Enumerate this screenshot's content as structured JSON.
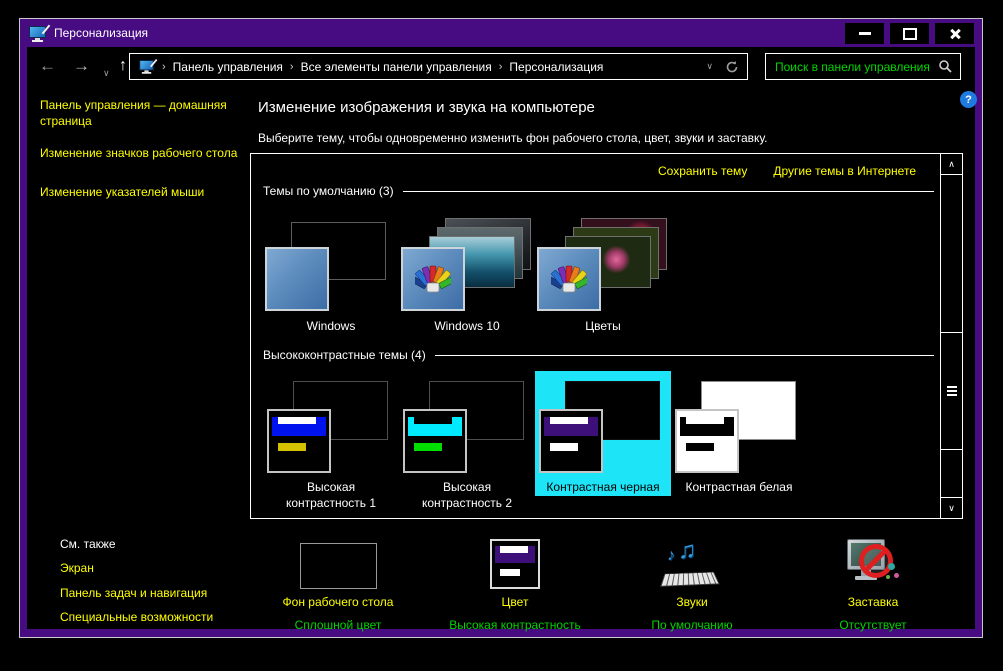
{
  "window": {
    "title": "Персонализация"
  },
  "nav": {
    "breadcrumb_items": [
      "Панель управления",
      "Все элементы панели управления",
      "Персонализация"
    ],
    "search_placeholder": "Поиск в панели управления"
  },
  "help": {
    "glyph": "?"
  },
  "sidebar": {
    "links": [
      "Панель управления — домашняя страница",
      "Изменение значков рабочего стола",
      "Изменение указателей мыши"
    ]
  },
  "content": {
    "heading": "Изменение изображения и звука на компьютере",
    "subheading": "Выберите тему, чтобы одновременно изменить фон рабочего стола, цвет, звуки и заставку.",
    "panel": {
      "save_theme_link": "Сохранить тему",
      "online_themes_link": "Другие темы в Интернете",
      "default_group": {
        "title": "Темы по умолчанию (3)",
        "themes": [
          {
            "label": "Windows"
          },
          {
            "label": "Windows 10"
          },
          {
            "label": "Цветы"
          }
        ]
      },
      "high_contrast_group": {
        "title": "Высококонтрастные темы (4)",
        "themes": [
          {
            "label": "Высокая контрастность 1",
            "selected": false
          },
          {
            "label": "Высокая контрастность 2",
            "selected": false
          },
          {
            "label": "Контрастная черная",
            "selected": true
          },
          {
            "label": "Контрастная белая",
            "selected": false
          }
        ]
      }
    }
  },
  "see_also": {
    "title": "См. также",
    "links": [
      "Экран",
      "Панель задач и навигация",
      "Специальные возможности"
    ]
  },
  "settings": [
    {
      "label": "Фон рабочего стола",
      "value": "Сплошной цвет"
    },
    {
      "label": "Цвет",
      "value": "Высокая контрастность"
    },
    {
      "label": "Звуки",
      "value": "По умолчанию"
    },
    {
      "label": "Заставка",
      "value": "Отсутствует"
    }
  ],
  "colors": {
    "accent_purple": "#470b82",
    "selection_cyan": "#1de4f7",
    "link_yellow": "#ffff00",
    "value_green": "#00d500",
    "hc1_band": "#0013ef",
    "hc1_stripe": "#d6c100",
    "hc2_band": "#00eaff",
    "hc2_stripe": "#00dd00",
    "hc_black_band": "#3c0f79"
  }
}
